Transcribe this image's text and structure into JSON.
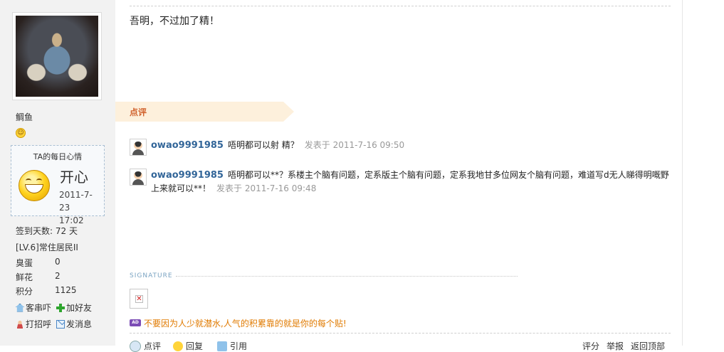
{
  "profile": {
    "username": "鲷鱼",
    "mood_title": "TA的每日心情",
    "mood_word": "开心",
    "mood_date": "2011-7-23",
    "mood_time": "17:02",
    "checkin": "签到天数: 72 天",
    "level": "[LV.6]常住居民II",
    "stats": [
      {
        "label": "臭蛋",
        "value": "0"
      },
      {
        "label": "鲜花",
        "value": "2"
      },
      {
        "label": "积分",
        "value": "1125"
      }
    ],
    "actions": [
      {
        "label": "客串吓",
        "icon": "home-icon"
      },
      {
        "label": "加好友",
        "icon": "plus-icon"
      },
      {
        "label": "打招呼",
        "icon": "person-icon"
      },
      {
        "label": "发消息",
        "icon": "mail-icon"
      }
    ]
  },
  "post": {
    "text": "吾明，不过加了精！"
  },
  "comments": {
    "header": "点评",
    "items": [
      {
        "author": "owao9991985",
        "text": "唔明都可以射 精？",
        "time": "发表于 2011-7-16 09:50"
      },
      {
        "author": "owao9991985",
        "text": "唔明都可以**？系楼主个脑有问题，定系版主个脑有问题，定系我地甘多位网友个脑有问题，难道写d无人睇得明嘅野上来就可以**！",
        "time": "发表于 2011-7-16 09:48"
      }
    ]
  },
  "signature": {
    "label": "SIGNATURE",
    "ad_badge": "AD",
    "ad_text": "不要因为人少就潜水,人气的积累靠的就是你的每个贴!"
  },
  "footer": {
    "left": [
      "点评",
      "回复",
      "引用"
    ],
    "right": [
      "评分",
      "举报",
      "返回顶部"
    ]
  }
}
